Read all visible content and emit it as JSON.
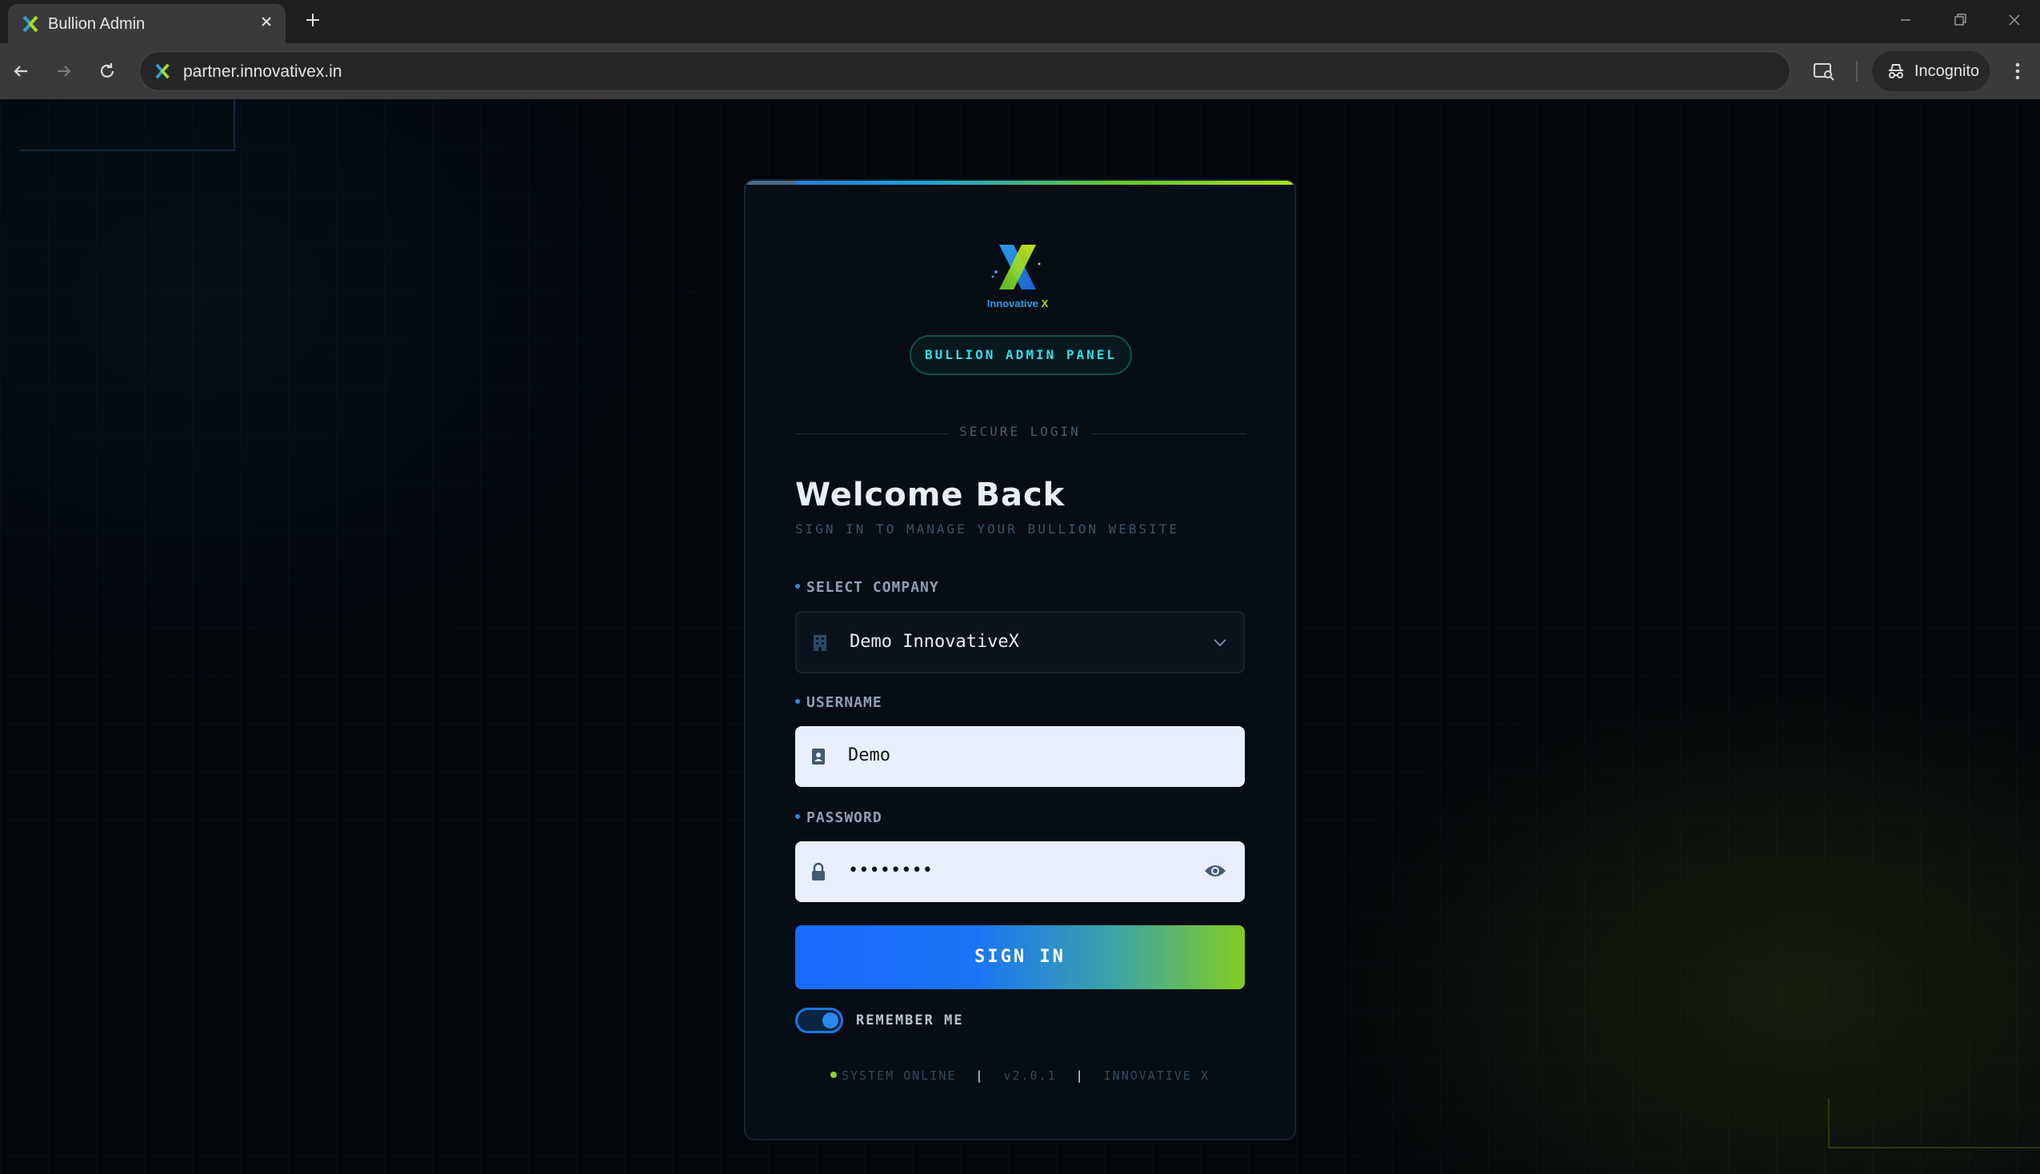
{
  "browser": {
    "tab_title": "Bullion Admin",
    "url": "partner.innovativex.in",
    "incognito_label": "Incognito"
  },
  "brand": {
    "logo_text_1": "Innovative",
    "logo_text_2": "X",
    "colors": {
      "blue": "#2a9ee6",
      "green": "#a6e11a",
      "cyan": "#2ee0e8"
    }
  },
  "login": {
    "badge": "BULLION ADMIN PANEL",
    "divider_text": "SECURE LOGIN",
    "title": "Welcome Back",
    "subtitle": "SIGN IN TO MANAGE YOUR BULLION WEBSITE",
    "company_label": "SELECT COMPANY",
    "company_value": "Demo InnovativeX",
    "username_label": "USERNAME",
    "username_value": "Demo",
    "password_label": "PASSWORD",
    "password_value": "••••••••",
    "signin_label": "SIGN IN",
    "remember_label": "REMEMBER ME",
    "remember_checked": true
  },
  "footer": {
    "status": "SYSTEM ONLINE",
    "version": "v2.0.1",
    "brand": "INNOVATIVE X"
  }
}
